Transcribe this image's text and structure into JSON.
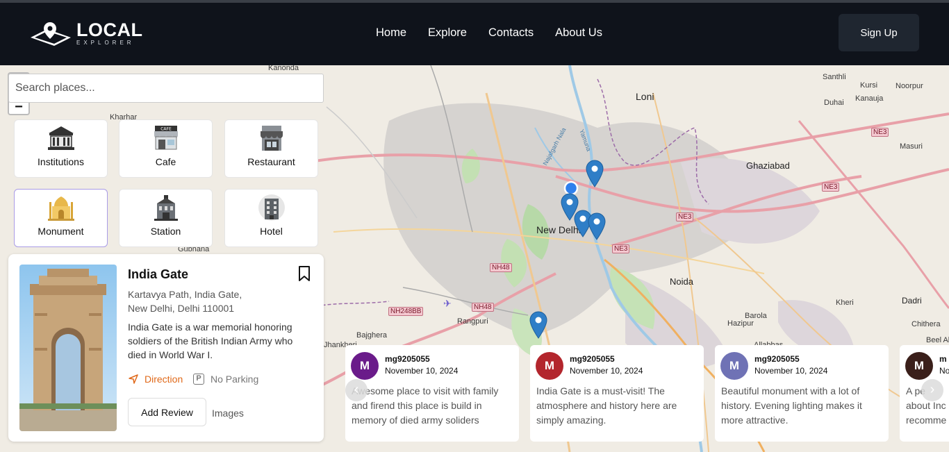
{
  "brand": {
    "title": "LOCAL",
    "subtitle": "EXPLORER"
  },
  "nav": {
    "items": [
      "Home",
      "Explore",
      "Contacts",
      "About Us"
    ],
    "signup": "Sign Up"
  },
  "search": {
    "placeholder": "Search places..."
  },
  "categories": [
    {
      "label": "Institutions",
      "icon": "institution-icon"
    },
    {
      "label": "Cafe",
      "icon": "cafe-icon"
    },
    {
      "label": "Restaurant",
      "icon": "restaurant-icon"
    },
    {
      "label": "Monument",
      "icon": "monument-icon",
      "active": true
    },
    {
      "label": "Station",
      "icon": "station-icon"
    },
    {
      "label": "Hotel",
      "icon": "hotel-icon"
    }
  ],
  "map": {
    "labels": [
      "Kanonda",
      "Kharhar",
      "Loni",
      "Santhli",
      "Kursi",
      "Noorpur",
      "Duhai",
      "Kanauja",
      "Masuri",
      "Ghaziabad",
      "New Delhi",
      "Noida",
      "Kheri",
      "Dadri",
      "Barola",
      "Hazipur",
      "Chithera",
      "Rangpuri",
      "Bajghera",
      "Jhankheri",
      "Gubhana",
      "Najafgarh Nala",
      "Yamuna",
      "Beel Ak",
      "Allabbas"
    ],
    "shields": [
      "NE3",
      "NE3",
      "NE3",
      "NE3",
      "NH48",
      "NH48",
      "NH248BB"
    ]
  },
  "place": {
    "title": "India Gate",
    "address_line1": "Kartavya Path, India Gate,",
    "address_line2": "New Delhi, Delhi 110001",
    "description": "India Gate is a war memorial honoring soldiers of the British Indian Army who died in World War I.",
    "direction": "Direction",
    "parking": "No Parking",
    "parking_symbol": "P",
    "add_review": "Add Review",
    "images": "Images"
  },
  "reviews": [
    {
      "initial": "M",
      "user": "mg9205055",
      "date": "November 10, 2024",
      "text": "Awesome place to visit with family and firend this place is build in memory of died army soliders",
      "color": "#6a1b8a"
    },
    {
      "initial": "M",
      "user": "mg9205055",
      "date": "November 10, 2024",
      "text": "India Gate is a must-visit! The atmosphere and history here are simply amazing.",
      "color": "#b3262d"
    },
    {
      "initial": "M",
      "user": "mg9205055",
      "date": "November 10, 2024",
      "text": "Beautiful monument with a lot of history. Evening lighting makes it more attractive.",
      "color": "#6f72b5"
    },
    {
      "initial": "M",
      "user": "m",
      "date": "No",
      "text": "A pe about Inc recomme",
      "color": "#3a1f1a"
    }
  ],
  "carousel": {
    "prev": "‹",
    "next": "›"
  },
  "colors": {
    "navbar": "#0f131b",
    "accent_direction": "#e0691a",
    "pin": "#2f7ec7",
    "active_border": "#a99be6"
  }
}
